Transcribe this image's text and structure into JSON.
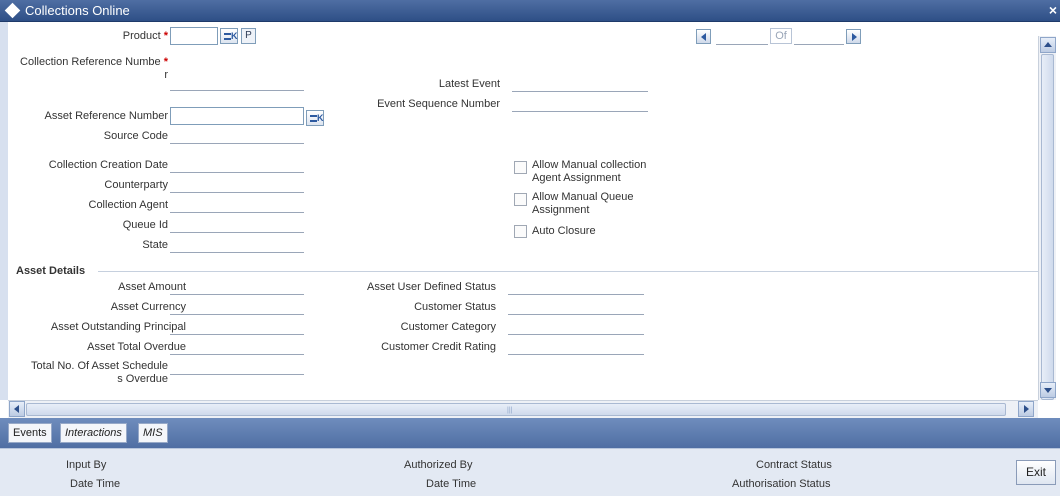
{
  "window": {
    "title": "Collections Online",
    "close_icon": "×"
  },
  "header": {
    "product_label": "Product",
    "product_required": "*",
    "p_button": "P",
    "of_label": "Of",
    "collection_ref_label_1": "Collection Reference Numbe",
    "collection_ref_label_2": "r",
    "collection_ref_required": "*",
    "asset_ref_label": "Asset Reference Number",
    "source_code_label": "Source Code",
    "latest_event_label": "Latest Event",
    "event_seq_label": "Event Sequence Number"
  },
  "details": {
    "collection_creation_date": "Collection Creation Date",
    "counterparty": "Counterparty",
    "collection_agent": "Collection Agent",
    "queue_id": "Queue Id",
    "state": "State"
  },
  "checkboxes": {
    "manual_agent_1": "Allow Manual collection",
    "manual_agent_2": "Agent Assignment",
    "manual_queue_1": "Allow Manual Queue",
    "manual_queue_2": "Assignment",
    "auto_closure": "Auto Closure"
  },
  "asset": {
    "section_title": "Asset Details",
    "amount": "Asset Amount",
    "currency": "Asset Currency",
    "outstanding_principal": "Asset Outstanding Principal",
    "total_overdue": "Asset Total Overdue",
    "schedules_overdue_1": "Total No. Of Asset Schedule",
    "schedules_overdue_2": "s Overdue",
    "user_defined_status": "Asset User Defined Status",
    "customer_status": "Customer Status",
    "customer_category": "Customer Category",
    "customer_credit_rating": "Customer Credit Rating"
  },
  "tabs": {
    "events": "Events",
    "interactions": "Interactions",
    "mis": "MIS"
  },
  "footer": {
    "input_by": "Input By",
    "date_time_1": "Date Time",
    "authorized_by": "Authorized By",
    "date_time_2": "Date Time",
    "contract_status": "Contract Status",
    "authorisation_status": "Authorisation Status",
    "exit": "Exit"
  }
}
